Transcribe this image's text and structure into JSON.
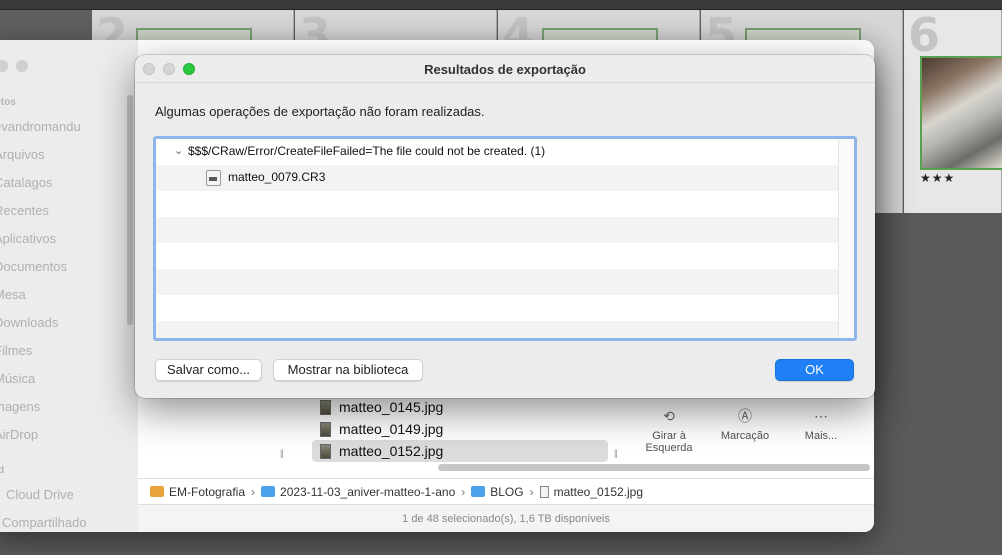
{
  "filmstrip": {
    "cells": [
      {
        "number": "2"
      },
      {
        "number": "3"
      },
      {
        "number": "4"
      },
      {
        "number": "5"
      },
      {
        "number": "6",
        "stars": "★★★"
      }
    ]
  },
  "finder": {
    "sidebar": {
      "section_favorites": "itos",
      "items": [
        "evandromandu",
        "Arquivos",
        "Catalagos",
        "Recentes",
        "Aplicativos",
        "Documentos",
        "Mesa",
        "Downloads",
        "Filmes",
        "Música",
        "magens",
        "AirDrop"
      ],
      "section_locations": "d",
      "locations": [
        "Cloud Drive",
        "Compartilhado"
      ]
    },
    "files": [
      {
        "name": "matteo_0145.jpg",
        "selected": false
      },
      {
        "name": "matteo_0149.jpg",
        "selected": false
      },
      {
        "name": "matteo_0152.jpg",
        "selected": true
      }
    ],
    "preview_tools": [
      {
        "icon": "rotate-left-icon",
        "label": "Girar à Esquerda"
      },
      {
        "icon": "markup-icon",
        "label": "Marcação"
      },
      {
        "icon": "more-icon",
        "label": "Mais..."
      }
    ],
    "path": [
      {
        "label": "EM-Fotografia",
        "icon": "drive-icon"
      },
      {
        "label": "2023-11-03_aniver-matteo-1-ano",
        "icon": "folder-icon"
      },
      {
        "label": "BLOG",
        "icon": "folder-icon"
      },
      {
        "label": "matteo_0152.jpg",
        "icon": "file-icon"
      }
    ],
    "status": "1 de 48 selecionado(s), 1,6 TB disponíveis"
  },
  "dialog": {
    "title": "Resultados de exportação",
    "message": "Algumas operações de exportação não foram realizadas.",
    "error_group": "$$$/CRaw/Error/CreateFileFailed=The file could not be created. (1)",
    "error_file": "matteo_0079.CR3",
    "buttons": {
      "save_as": "Salvar como...",
      "show_in_library": "Mostrar na biblioteca",
      "ok": "OK"
    }
  }
}
